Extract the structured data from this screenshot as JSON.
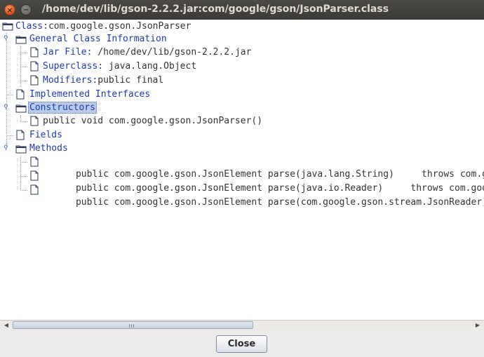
{
  "window": {
    "title": "/home/dev/lib/gson-2.2.2.jar:com/google/gson/JsonParser.class",
    "close_glyph": "×",
    "minimize_glyph": "−"
  },
  "tree": {
    "root": {
      "label": "Class:",
      "value": "com.google.gson.JsonParser"
    },
    "general": {
      "label": "General Class Information",
      "jar": {
        "label": "Jar File:",
        "value": " /home/dev/lib/gson-2.2.2.jar"
      },
      "superclass": {
        "label": "Superclass:",
        "value": " java.lang.Object"
      },
      "modifiers": {
        "label": "Modifiers:",
        "value": "public final"
      }
    },
    "interfaces": {
      "label": "Implemented Interfaces"
    },
    "constructors": {
      "label": "Constructors",
      "items": [
        "public void com.google.gson.JsonParser()"
      ]
    },
    "fields": {
      "label": "Fields"
    },
    "methods": {
      "label": "Methods",
      "items": [
        "public com.google.gson.JsonElement parse(java.lang.String)     throws com.google.gson.JsonIOException",
        "public com.google.gson.JsonElement parse(java.io.Reader)     throws com.google.gson.JsonIOException",
        "public com.google.gson.JsonElement parse(com.google.gson.stream.JsonReader)"
      ]
    }
  },
  "scrollbar": {
    "left_arrow": "◀",
    "right_arrow": "▶"
  },
  "footer": {
    "close_label": "Close"
  }
}
